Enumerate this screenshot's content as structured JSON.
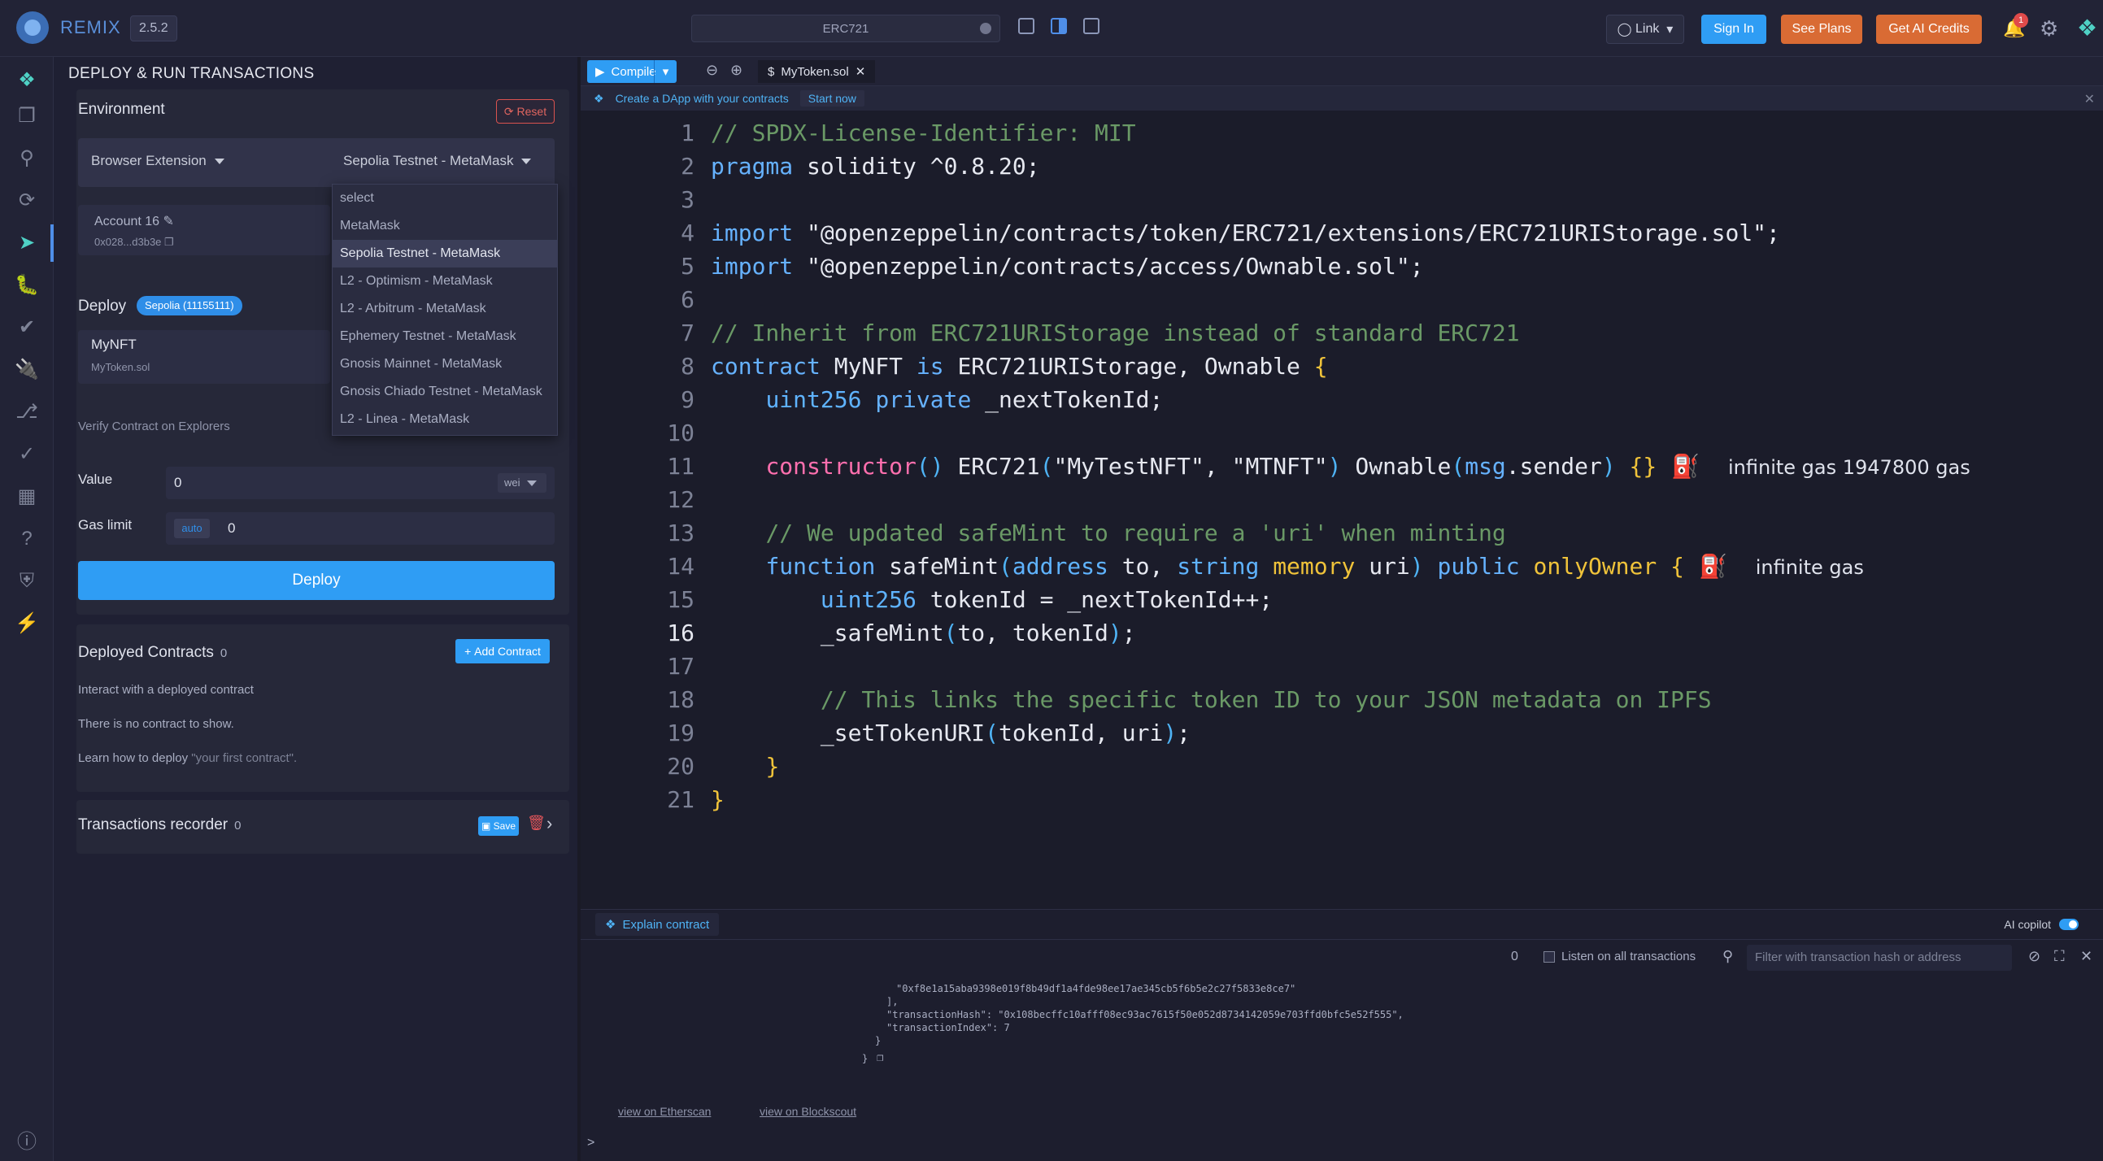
{
  "app": {
    "name": "REMIX",
    "version": "2.5.2",
    "workspace_title": "ERC721"
  },
  "topbar": {
    "link_label": "Link",
    "signin_label": "Sign In",
    "plans_label": "See Plans",
    "credits_label": "Get AI Credits",
    "notification_count": "1"
  },
  "panel": {
    "title": "DEPLOY & RUN TRANSACTIONS",
    "environment": {
      "label": "Environment",
      "reset_label": "Reset",
      "provider": "Browser Extension",
      "network": "Sepolia Testnet - MetaMask",
      "account_name": "Account 16",
      "account_address": "0x028...d3b3e",
      "dropdown_options": [
        "select",
        "MetaMask",
        "Sepolia Testnet - MetaMask",
        "L2 - Optimism - MetaMask",
        "L2 - Arbitrum - MetaMask",
        "Ephemery Testnet - MetaMask",
        "Gnosis Mainnet - MetaMask",
        "Gnosis Chiado Testnet - MetaMask",
        "L2 - Linea - MetaMask"
      ]
    },
    "deploy": {
      "label": "Deploy",
      "badge": "Sepolia (11155111)",
      "contract_name": "MyNFT",
      "contract_file": "MyToken.sol",
      "verify_label": "Verify Contract on Explorers",
      "value_label": "Value",
      "value": "0",
      "unit": "wei",
      "gas_label": "Gas limit",
      "gas_auto": "auto",
      "gas_value": "0",
      "deploy_button": "Deploy"
    },
    "deployed": {
      "label": "Deployed Contracts",
      "count": "0",
      "add_label": "Add Contract",
      "line1": "Interact with a deployed contract",
      "line2": "There is no contract to show.",
      "line3_prefix": "Learn how to deploy",
      "line3_quote": "\"your first contract\"."
    },
    "recorder": {
      "label": "Transactions recorder",
      "count": "0",
      "save_label": "Save"
    }
  },
  "editor": {
    "compile_label": "Compile",
    "file_tab": "MyToken.sol",
    "banner_text": "Create a DApp with your contracts",
    "banner_cta": "Start now",
    "current_line": 16
  },
  "code_lines": [
    "// SPDX-License-Identifier: MIT",
    "pragma solidity ^0.8.20;",
    "",
    "import \"@openzeppelin/contracts/token/ERC721/extensions/ERC721URIStorage.sol\";",
    "import \"@openzeppelin/contracts/access/Ownable.sol\";",
    "",
    "// Inherit from ERC721URIStorage instead of standard ERC721",
    "contract MyNFT is ERC721URIStorage, Ownable {",
    "    uint256 private _nextTokenId;",
    "",
    "    constructor() ERC721(\"MyTestNFT\", \"MTNFT\") Ownable(msg.sender) {}",
    "",
    "    // We updated safeMint to require a 'uri' when minting",
    "    function safeMint(address to, string memory uri) public onlyOwner {",
    "        uint256 tokenId = _nextTokenId++;",
    "        _safeMint(to, tokenId);",
    "",
    "        // This links the specific token ID to your JSON metadata on IPFS",
    "        _setTokenURI(tokenId, uri);",
    "    }",
    "}"
  ],
  "gas_estimates": {
    "line11": "infinite gas 1947800 gas",
    "line14": "infinite gas"
  },
  "terminal": {
    "explain_label": "Explain contract",
    "ai_copilot_label": "AI copilot",
    "tx_count": "0",
    "listen_label": "Listen on all transactions",
    "filter_placeholder": "Filter with transaction hash or address",
    "log_lines": [
      "\"0xf8e1a15aba9398e019f8b49df1a4fde98ee17ae345cb5f6b5e2c27f5833e8ce7\"",
      "],",
      "\"transactionHash\": \"0x108becffc10afff08ec93ac7615f50e052d8734142059e703ffd0bfc5e52f555\",",
      "\"transactionIndex\": 7",
      "}",
      "}"
    ],
    "link_etherscan": "view on Etherscan",
    "link_blockscout": "view on Blockscout",
    "prompt": ">"
  }
}
